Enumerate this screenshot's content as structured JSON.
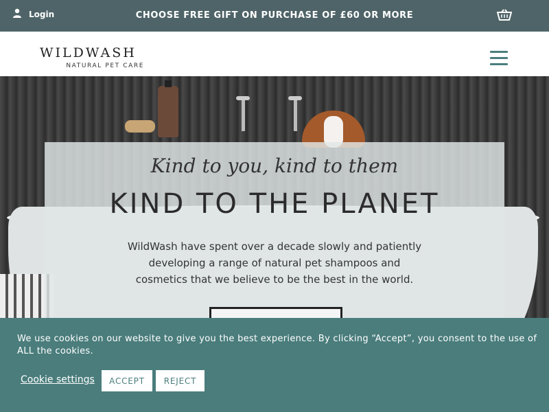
{
  "topbar": {
    "login_label": "Login",
    "login_icon": "user-icon",
    "promo_text": "CHOOSE FREE GIFT ON PURCHASE OF £60 OR MORE",
    "cart_icon": "basket-icon"
  },
  "header": {
    "logo_main": "WILDWASH",
    "logo_sub": "NATURAL PET CARE",
    "menu_icon": "hamburger-menu-icon"
  },
  "hero": {
    "tagline": "Kind to you, kind to them",
    "headline": "KIND TO THE PLANET",
    "description": "WildWash have spent over a decade slowly and patiently developing a range of natural pet shampoos and cosmetics that we believe to be the best in the world."
  },
  "cookie_banner": {
    "text": "We use cookies on our website to give you the best experience. By clicking “Accept”, you consent to the use of ALL the cookies.",
    "settings_label": "Cookie settings",
    "accept_label": "ACCEPT",
    "reject_label": "REJECT"
  },
  "colors": {
    "topbar": "#4f6468",
    "accent": "#4a7d7c",
    "cookie_bg": "#4a7d7c"
  }
}
